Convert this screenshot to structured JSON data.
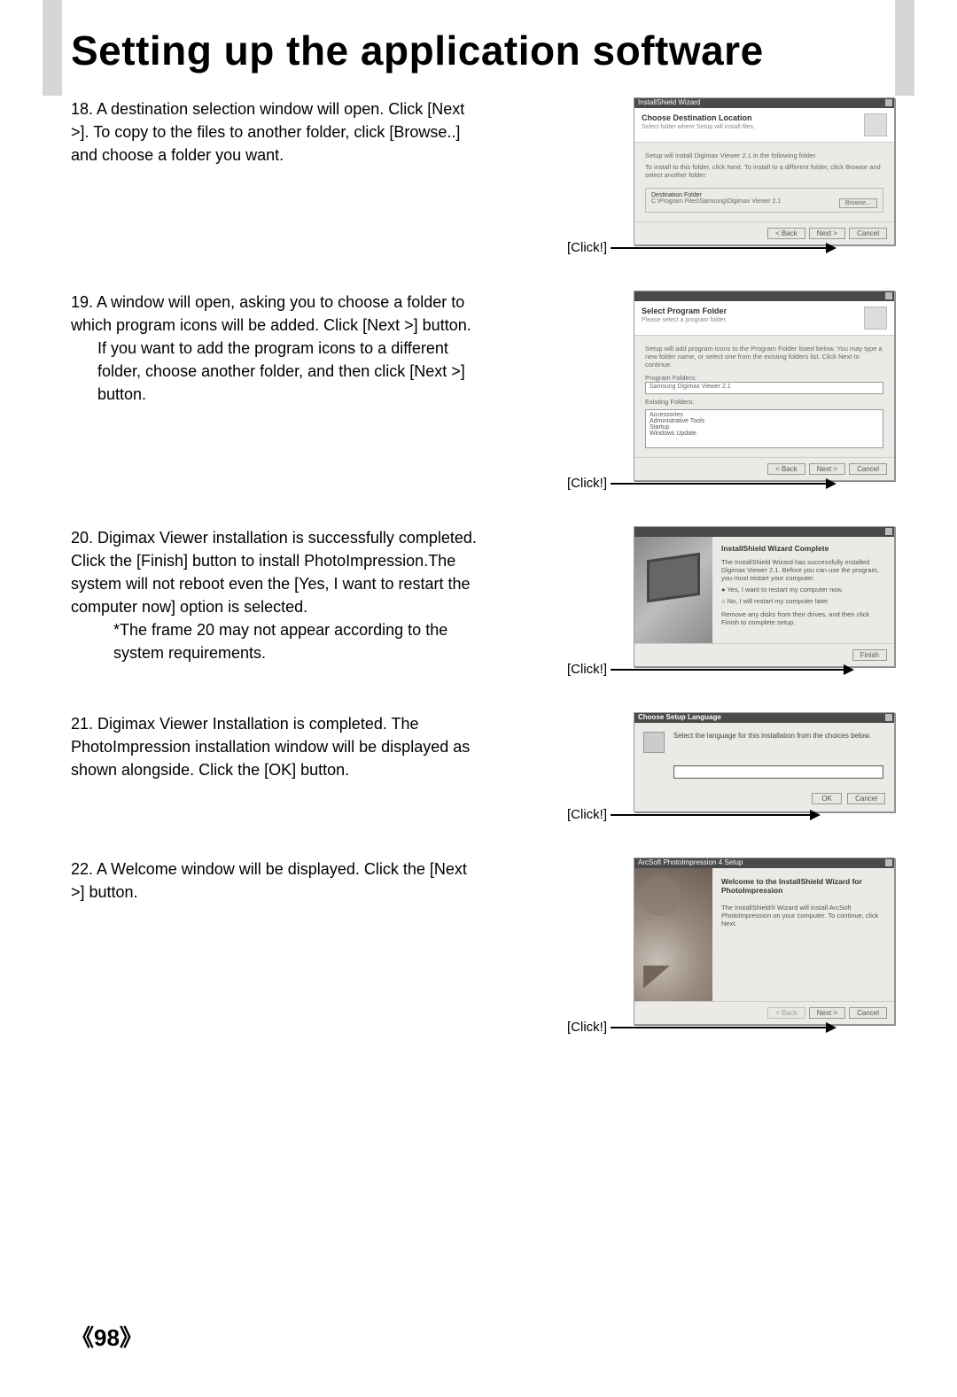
{
  "title": "Setting up the application software",
  "page_number": "《98》",
  "click_label": "[Click!]",
  "steps": {
    "s18": {
      "num": "18. ",
      "text": "A destination selection window will open. Click [Next >]. To copy to the files to another folder, click [Browse..] and choose a folder you want.",
      "dialog": {
        "winname": "InstallShield Wizard",
        "heading": "Choose Destination Location",
        "sub": "Select folder where Setup will install files.",
        "body1": "Setup will install Digimax Viewer 2.1 in the following folder.",
        "body2": "To install to this folder, click Next. To install to a different folder, click Browse and select another folder.",
        "path_label": "Destination Folder",
        "path": "C:\\Program Files\\Samsung\\Digimax Viewer 2.1",
        "browse": "Browse...",
        "back": "< Back",
        "next": "Next >",
        "cancel": "Cancel"
      }
    },
    "s19": {
      "num": "19. ",
      "text_a": "A window will open, asking you to choose a folder to which program icons will be added. Click [Next >] button.",
      "text_b": "If you want to add the program icons to a different folder, choose another folder, and then click [Next >] button.",
      "dialog": {
        "heading": "Select Program Folder",
        "sub": "Please select a program folder.",
        "body": "Setup will add program icons to the Program Folder listed below. You may type a new folder name, or select one from the existing folders list. Click Next to continue.",
        "label1": "Program Folders:",
        "input_val": "Samsung Digimax Viewer 2.1",
        "label2": "Existing Folders:",
        "existing": [
          "Accessories",
          "Administrative Tools",
          "Startup",
          "Windows Update"
        ],
        "back": "< Back",
        "next": "Next >",
        "cancel": "Cancel"
      }
    },
    "s20": {
      "num": "20. ",
      "text": "Digimax Viewer installation is successfully completed. Click the [Finish] button to install PhotoImpression.The system will not reboot even the [Yes, I want to restart the computer now] option is selected.",
      "note": "*The frame 20 may not appear according to the system requirements.",
      "dialog": {
        "heading": "InstallShield Wizard Complete",
        "body": "The InstallShield Wizard has successfully installed Digimax Viewer 2.1. Before you can use the program, you must restart your computer.",
        "opt1": "Yes, I want to restart my computer now.",
        "opt2": "No, I will restart my computer later.",
        "tail": "Remove any disks from their drives, and then click Finish to complete setup.",
        "finish": "Finish"
      }
    },
    "s21": {
      "num": "21. ",
      "text": "Digimax Viewer Installation is completed. The PhotoImpression installation window will be displayed as shown alongside. Click the [OK] button.",
      "dialog": {
        "title": "Choose Setup Language",
        "body": "Select the language for this installation from the choices below.",
        "ok": "OK",
        "cancel": "Cancel"
      }
    },
    "s22": {
      "num": "22. ",
      "text": "A Welcome window will be displayed. Click the [Next >] button.",
      "dialog": {
        "winname": "ArcSoft PhotoImpression 4 Setup",
        "heading": "Welcome to the InstallShield Wizard for PhotoImpression",
        "body": "The InstallShield® Wizard will install ArcSoft PhotoImpression on your computer. To continue, click Next.",
        "back": "< Back",
        "next": "Next >",
        "cancel": "Cancel"
      }
    }
  }
}
